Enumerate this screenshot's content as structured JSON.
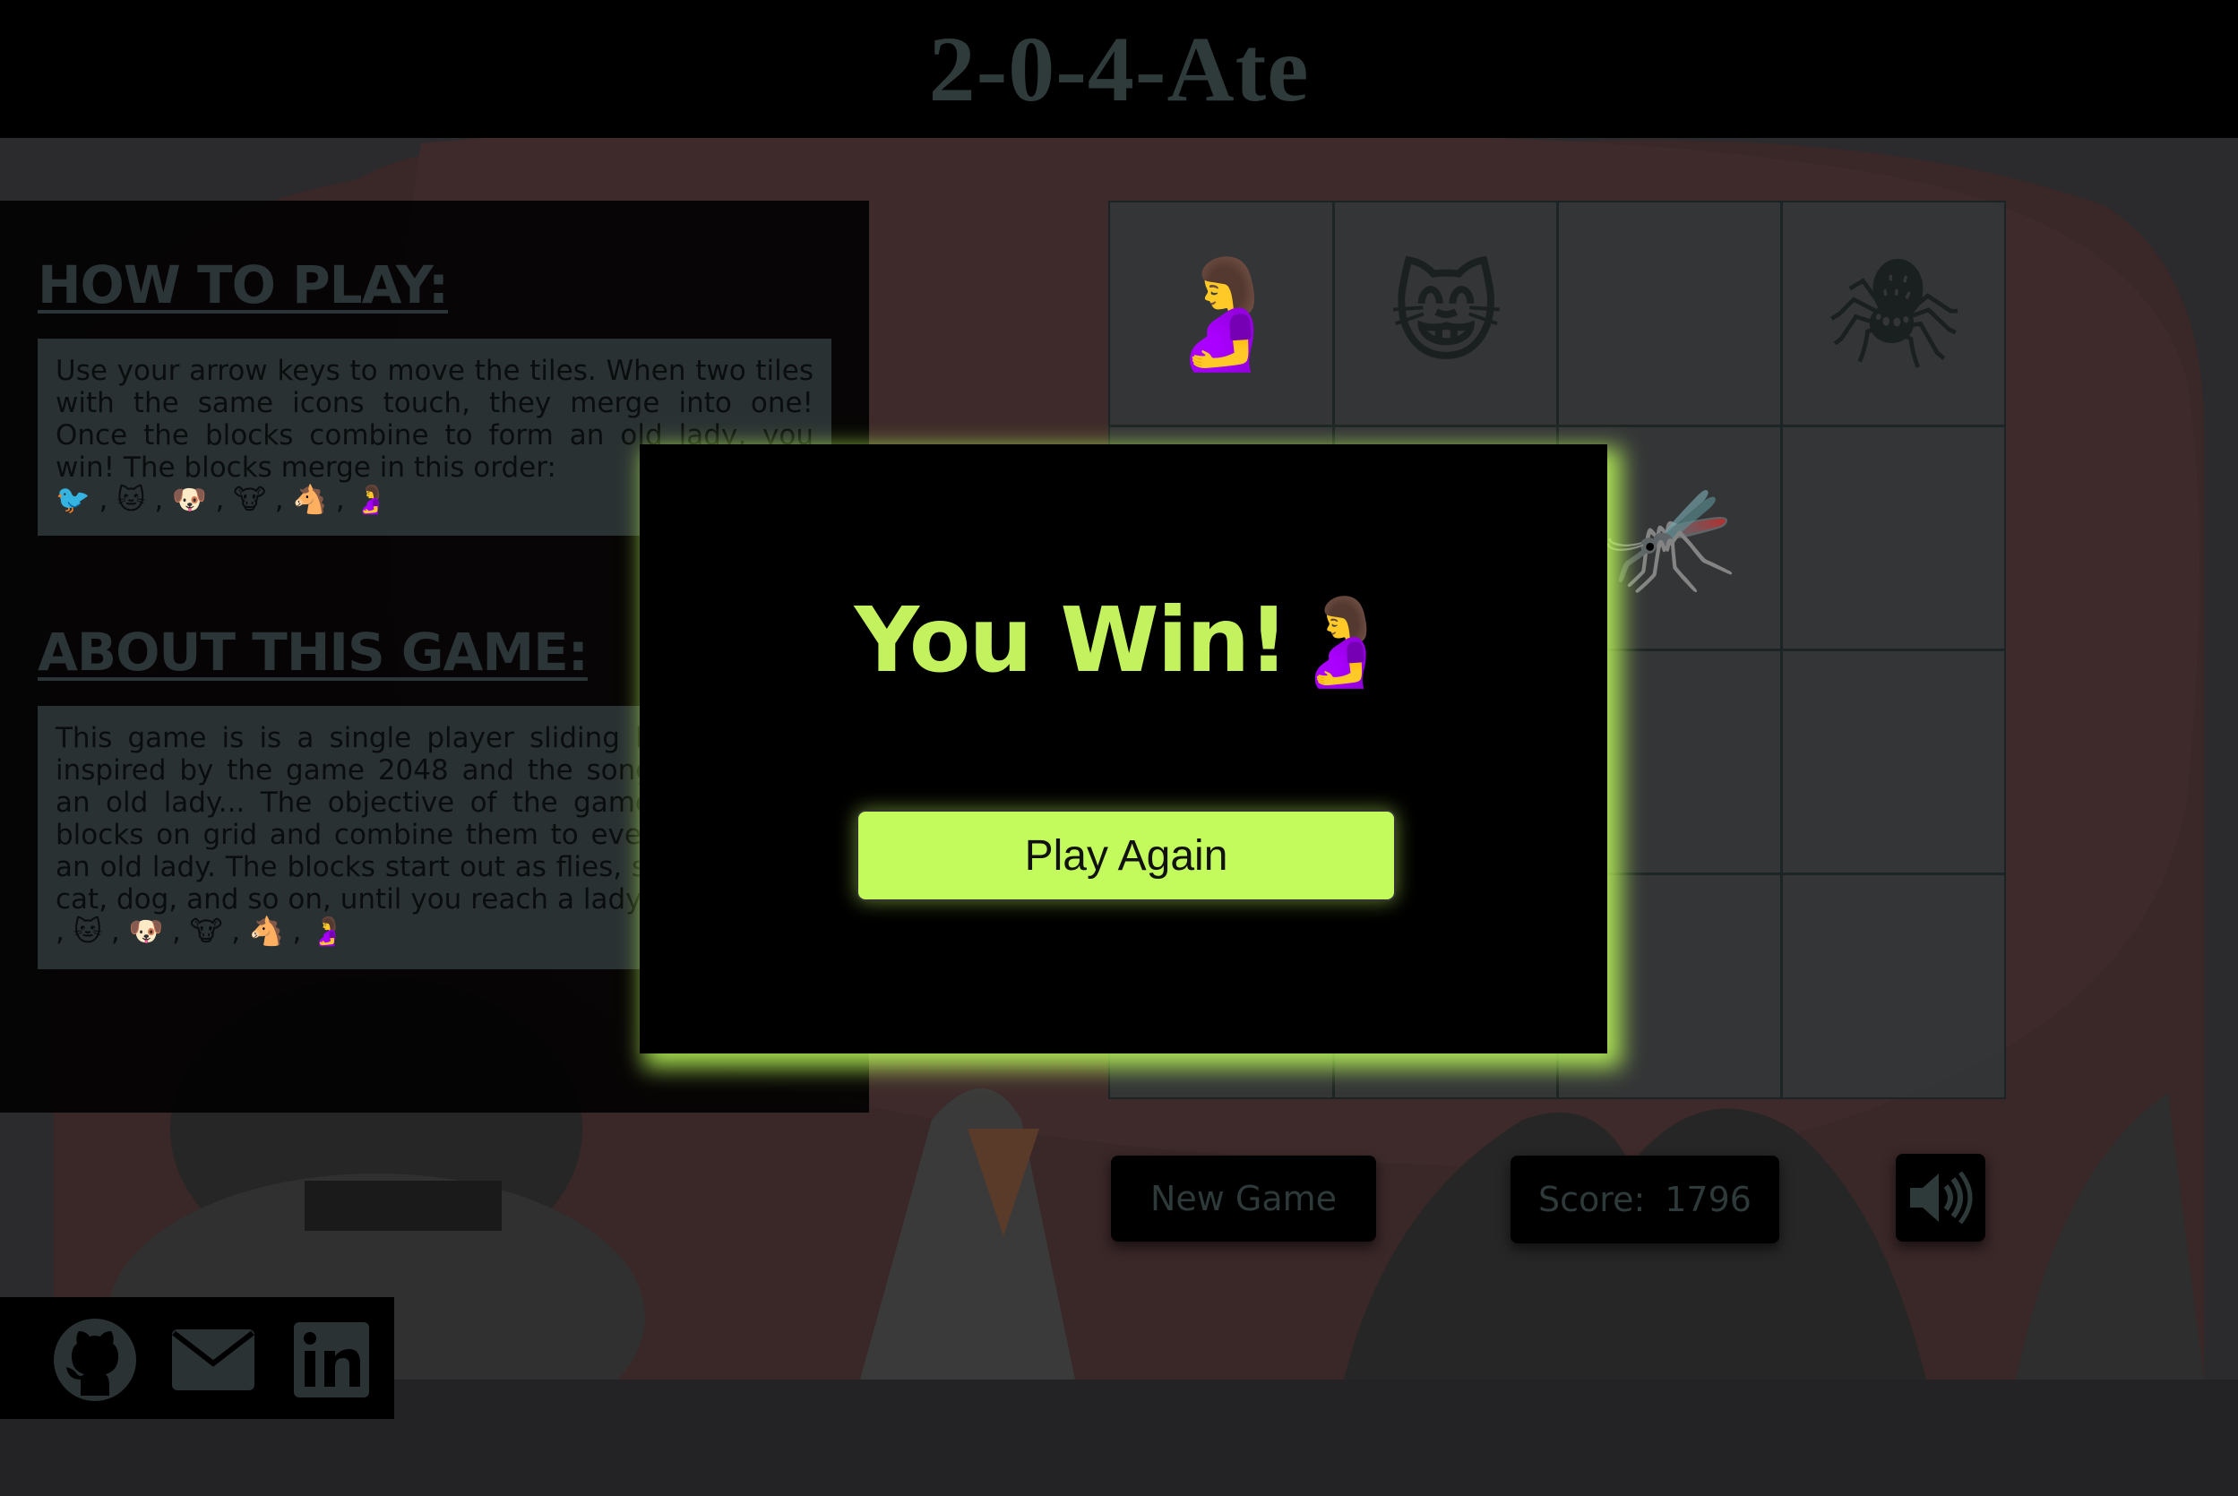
{
  "header": {
    "title": "2-0-4-Ate"
  },
  "how_to_play": {
    "heading": "HOW TO PLAY:",
    "body": "Use your arrow keys to move the tiles. When two tiles with the same icons touch, they merge into one! Once the blocks combine to form an old lady, you win! The blocks merge in this order:",
    "order_glyphs": "🐦 , 🐱 , 🐶 , 🐮 , 🐴 , 🤰"
  },
  "about": {
    "heading": "ABOUT THIS GAME:",
    "body": "This game is is a single player sliding block puzzle inspired by the game 2048 and the song There was an old lady... The objective of the game is to slide blocks on grid and combine them to eventually form an old lady. The blocks start out as flies, spiders, bird, cat, dog, and so on, until you reach a lady.",
    "order_glyphs": "🪰 , 🕷 , 🐦 , 🐱 , 🐶 , 🐮 , 🐴 , 🤰"
  },
  "board": {
    "tiles": [
      {
        "row": 0,
        "col": 0,
        "glyph": "🤰"
      },
      {
        "row": 0,
        "col": 1,
        "glyph": "😸"
      },
      {
        "row": 0,
        "col": 3,
        "glyph": "🕷"
      },
      {
        "row": 1,
        "col": 2,
        "glyph": "🦟"
      }
    ]
  },
  "controls": {
    "new_game": "New Game",
    "score_label": "Score:",
    "score_value": "1796",
    "sound_icon": "speaker-icon"
  },
  "modal": {
    "title": "You Win!",
    "title_glyph": "🤰",
    "button": "Play Again"
  },
  "social": {
    "icons": [
      "github-icon",
      "mail-icon",
      "linkedin-icon"
    ]
  },
  "colors": {
    "accent": "#c4fb5c",
    "win_text": "#c4f25e",
    "background": "#2b2b2e"
  }
}
